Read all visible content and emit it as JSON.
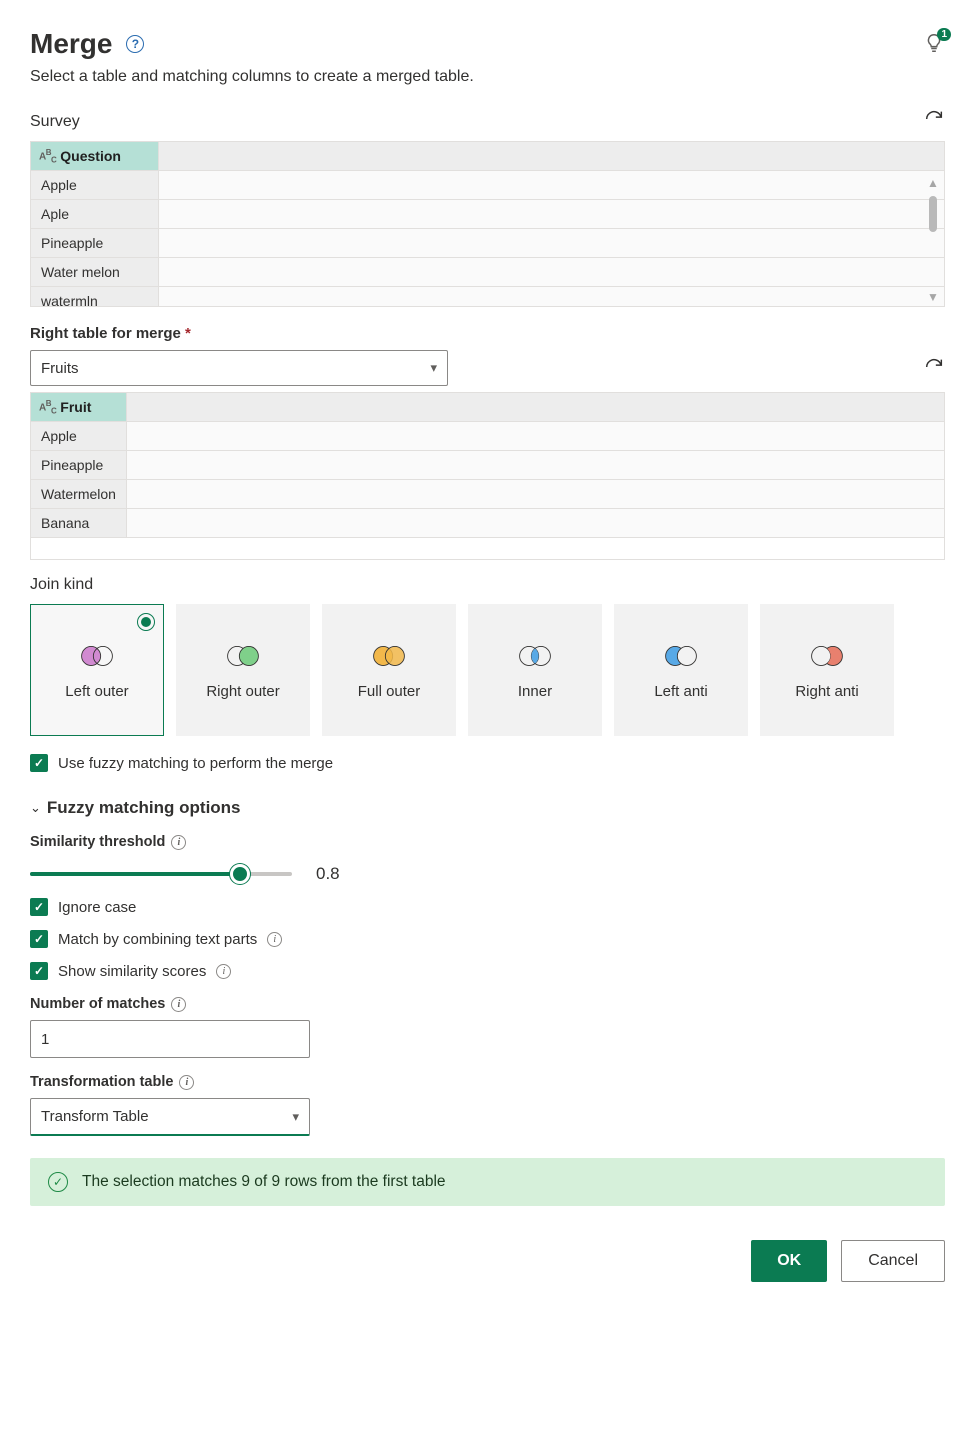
{
  "header": {
    "title": "Merge",
    "subtitle": "Select a table and matching columns to create a merged table.",
    "tips_badge": "1"
  },
  "left_table": {
    "label": "Survey",
    "column_header": "Question",
    "rows": [
      "Apple",
      "Aple",
      "Pineapple",
      "Water melon",
      "watermln"
    ]
  },
  "right_table_field": {
    "label": "Right table for merge",
    "value": "Fruits"
  },
  "right_table": {
    "column_header": "Fruit",
    "rows": [
      "Apple",
      "Pineapple",
      "Watermelon",
      "Banana"
    ]
  },
  "join": {
    "label": "Join kind",
    "selected": "Left outer",
    "options": [
      "Left outer",
      "Right outer",
      "Full outer",
      "Inner",
      "Left anti",
      "Right anti"
    ]
  },
  "fuzzy_checkbox": "Use fuzzy matching to perform the merge",
  "fuzzy_section": {
    "title": "Fuzzy matching options",
    "similarity_label": "Similarity threshold",
    "similarity_value": "0.8",
    "ignore_case": "Ignore case",
    "combine_text": "Match by combining text parts",
    "show_scores": "Show similarity scores",
    "num_matches_label": "Number of matches",
    "num_matches_value": "1",
    "transform_label": "Transformation table",
    "transform_value": "Transform Table"
  },
  "banner": "The selection matches 9 of 9 rows from the first table",
  "footer": {
    "ok": "OK",
    "cancel": "Cancel"
  }
}
